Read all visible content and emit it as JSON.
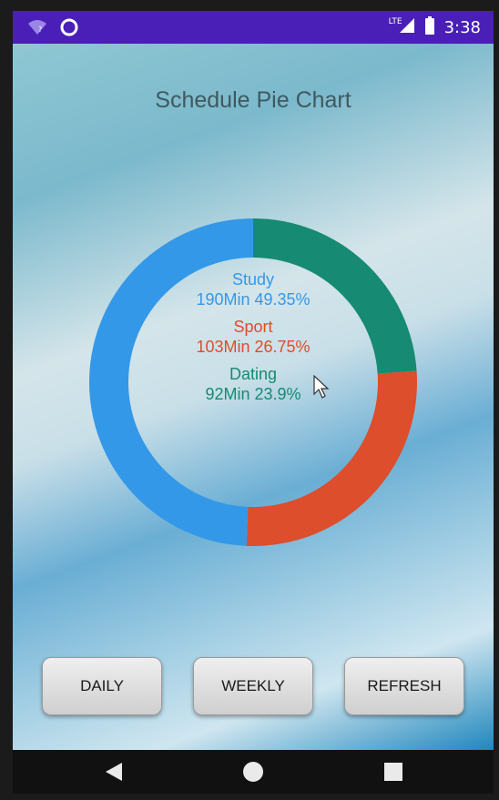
{
  "status_bar": {
    "time": "3:38",
    "network": "LTE",
    "icons": [
      "wifi-question-icon",
      "circle-notification-icon",
      "signal-icon",
      "battery-icon"
    ]
  },
  "screen": {
    "title": "Schedule Pie Chart"
  },
  "chart_data": {
    "type": "pie",
    "variant": "donut",
    "title": "",
    "series": [
      {
        "name": "Study",
        "minutes": 190,
        "label": "190Min 49.35%",
        "percent": 49.35,
        "color": "#3498e8"
      },
      {
        "name": "Sport",
        "minutes": 103,
        "label": "103Min 26.75%",
        "percent": 26.75,
        "color": "#dc4e2c"
      },
      {
        "name": "Dating",
        "minutes": 92,
        "label": "92Min 23.9%",
        "percent": 23.9,
        "color": "#168a72"
      }
    ]
  },
  "buttons": {
    "daily": "DAILY",
    "weekly": "WEEKLY",
    "refresh": "REFRESH"
  },
  "nav": {
    "icons": [
      "back-icon",
      "home-icon",
      "recents-icon"
    ]
  }
}
